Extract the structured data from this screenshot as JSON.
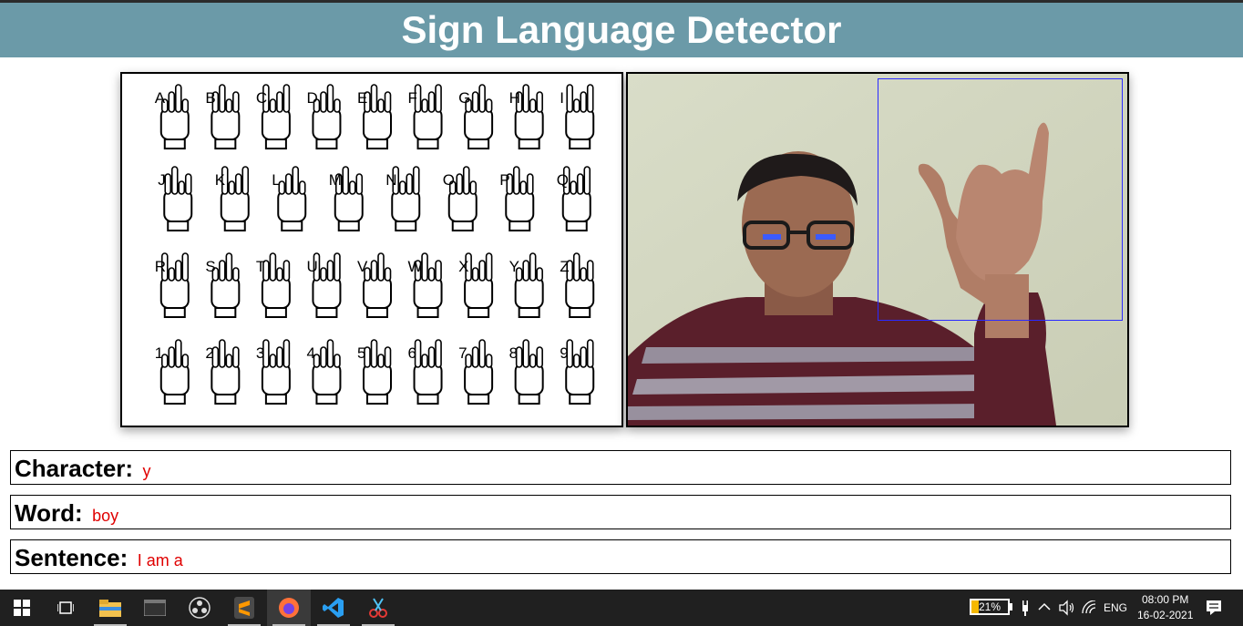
{
  "header": {
    "title": "Sign Language Detector"
  },
  "reference_chart": {
    "rows": [
      [
        "A",
        "B",
        "C",
        "D",
        "E",
        "F",
        "G",
        "H",
        "I"
      ],
      [
        "J",
        "K",
        "L",
        "M",
        "N",
        "O",
        "P",
        "Q"
      ],
      [
        "R",
        "S",
        "T",
        "U",
        "V",
        "W",
        "X",
        "Y",
        "Z"
      ],
      [
        "1",
        "2",
        "3",
        "4",
        "5",
        "6",
        "7",
        "8",
        "9"
      ]
    ]
  },
  "camera": {
    "detection_box_color": "#2a2aff"
  },
  "fields": {
    "character": {
      "label": "Character:",
      "value": "y"
    },
    "word": {
      "label": "Word:",
      "value": "boy"
    },
    "sentence": {
      "label": "Sentence:",
      "value": "I am a"
    }
  },
  "colors": {
    "header_bg": "#6b9aa8",
    "value_text": "#e00000"
  },
  "taskbar": {
    "apps": [
      "windows-start",
      "task-view",
      "file-explorer",
      "terminal",
      "obs",
      "sublime-text",
      "firefox",
      "vscode",
      "snipping-tool"
    ],
    "battery_percent": "21%",
    "language": "ENG",
    "time": "08:00 PM",
    "date": "16-02-2021"
  }
}
